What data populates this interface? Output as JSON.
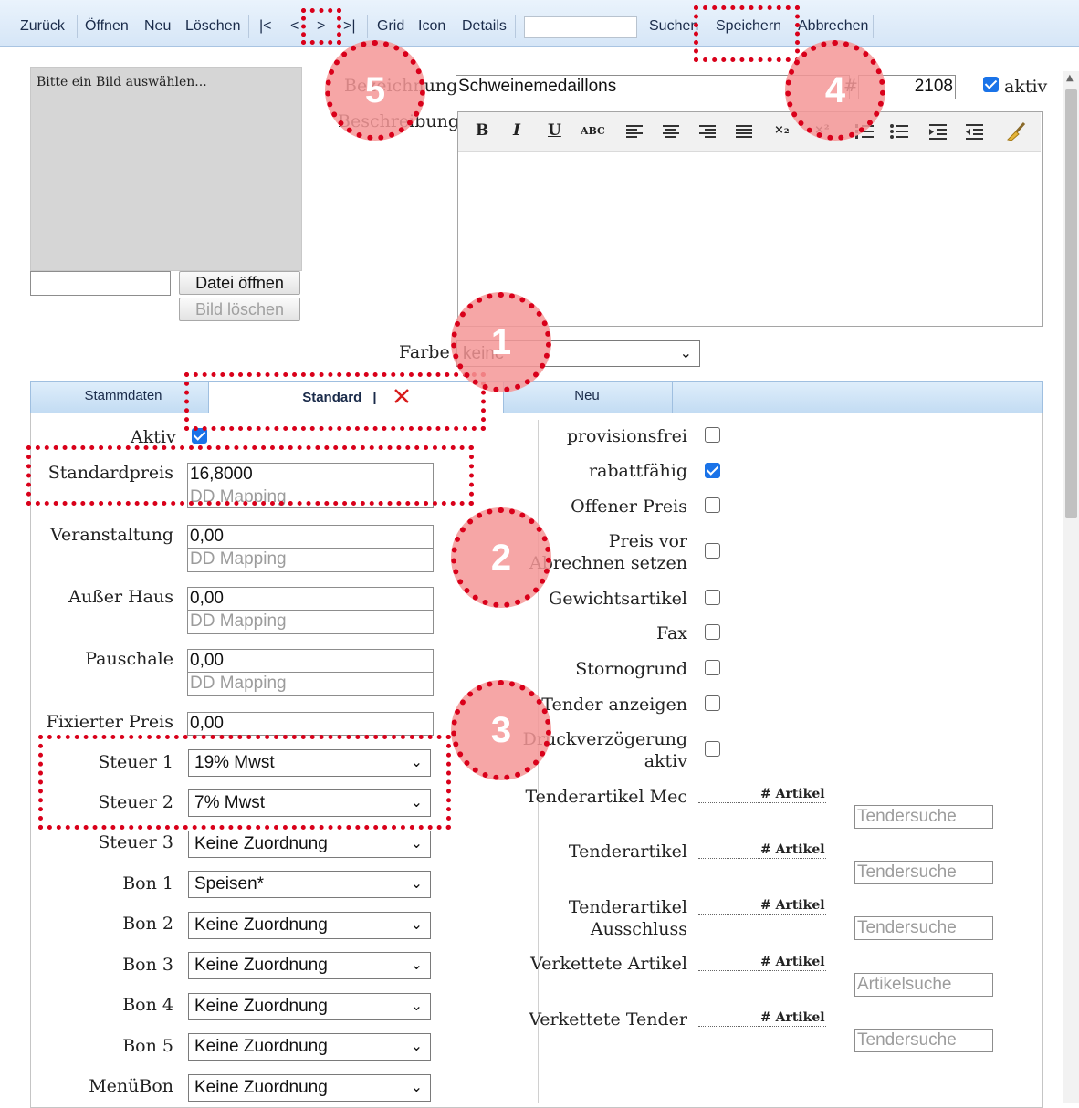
{
  "toolbar": {
    "back": "Zurück",
    "open": "Öffnen",
    "new": "Neu",
    "delete": "Löschen",
    "first": "|<",
    "prev": "<",
    "next": ">",
    "last": ">|",
    "grid": "Grid",
    "icon": "Icon",
    "details": "Details",
    "search": "Suchen",
    "save": "Speichern",
    "cancel": "Abbrechen"
  },
  "image": {
    "placeholder": "Bitte ein Bild auswählen...",
    "open_file": "Datei öffnen",
    "delete_image": "Bild löschen"
  },
  "header": {
    "name_label": "Bezeichnung",
    "name_value": "Schweinemedaillons",
    "number_label": "#",
    "number_value": "2108",
    "active_label": "aktiv",
    "active_checked": true,
    "description_label": "Beschreibung"
  },
  "editor": {
    "bold": "B",
    "italic": "I",
    "underline": "U",
    "strike": "ABC",
    "sub": "×₂",
    "sup": "×²"
  },
  "color": {
    "label": "Farbe",
    "value": "keine"
  },
  "tabs": {
    "stammdaten": "Stammdaten",
    "standard": "Standard",
    "standard_sep": "|",
    "neu": "Neu"
  },
  "left": {
    "aktiv_label": "Aktiv",
    "aktiv_checked": true,
    "dd_mapping": "DD Mapping",
    "prices": [
      {
        "label": "Standardpreis",
        "value": "16,8000"
      },
      {
        "label": "Veranstaltung",
        "value": "0,00"
      },
      {
        "label": "Außer Haus",
        "value": "0,00"
      },
      {
        "label": "Pauschale",
        "value": "0,00"
      },
      {
        "label": "Fixierter Preis",
        "value": "0,00"
      }
    ],
    "selects": [
      {
        "label": "Steuer 1",
        "value": "19% Mwst"
      },
      {
        "label": "Steuer 2",
        "value": "7% Mwst"
      },
      {
        "label": "Steuer 3",
        "value": "Keine Zuordnung"
      },
      {
        "label": "Bon 1",
        "value": "Speisen*"
      },
      {
        "label": "Bon 2",
        "value": "Keine Zuordnung"
      },
      {
        "label": "Bon 3",
        "value": "Keine Zuordnung"
      },
      {
        "label": "Bon 4",
        "value": "Keine Zuordnung"
      },
      {
        "label": "Bon 5",
        "value": "Keine Zuordnung"
      },
      {
        "label": "MenüBon",
        "value": "Keine Zuordnung"
      }
    ]
  },
  "right": {
    "checks": [
      {
        "label": "provisionsfrei",
        "checked": false
      },
      {
        "label": "rabattfähig",
        "checked": true
      },
      {
        "label": "Offener Preis",
        "checked": false
      },
      {
        "label": "Preis vor",
        "label2": "Abrechnen setzen",
        "checked": false
      },
      {
        "label": "Gewichtsartikel",
        "checked": false
      },
      {
        "label": "Fax",
        "checked": false
      },
      {
        "label": "Stornogrund",
        "checked": false
      },
      {
        "label": "Tender anzeigen",
        "checked": false
      },
      {
        "label": "Druckverzögerung",
        "label2": "aktiv",
        "checked": false
      }
    ],
    "artikel_header": "# Artikel",
    "tenders": [
      {
        "label": "Tenderartikel Mec",
        "search": "Tendersuche"
      },
      {
        "label": "Tenderartikel",
        "search": "Tendersuche"
      },
      {
        "label": "Tenderartikel",
        "label2": "Ausschluss",
        "search": "Tendersuche"
      },
      {
        "label": "Verkettete Artikel",
        "search": "Artikelsuche"
      },
      {
        "label": "Verkettete Tender",
        "search": "Tendersuche"
      }
    ]
  },
  "annotations": [
    "1",
    "2",
    "3",
    "4",
    "5"
  ]
}
